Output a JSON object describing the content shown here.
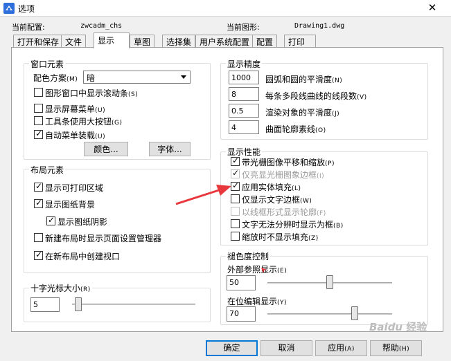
{
  "window": {
    "title": "选项",
    "close_glyph": "✕"
  },
  "header": {
    "current_config_label": "当前配置:",
    "current_config_value": "zwcadm_chs",
    "current_drawing_label": "当前图形:",
    "current_drawing_value": "Drawing1.dwg"
  },
  "tabs": [
    {
      "label": "打开和保存",
      "active": false
    },
    {
      "label": "文件",
      "active": false
    },
    {
      "label": "显示",
      "active": true
    },
    {
      "label": "草图",
      "active": false
    },
    {
      "label": "选择集",
      "active": false
    },
    {
      "label": "用户系统配置",
      "active": false
    },
    {
      "label": "配置",
      "active": false
    },
    {
      "label": "打印",
      "active": false
    }
  ],
  "window_elements": {
    "title": "窗口元素",
    "color_scheme_label": "配色方案",
    "color_scheme_key": "(M)",
    "color_scheme_value": "暗",
    "items": [
      {
        "label": "图形窗口中显示滚动条",
        "key": "(S)",
        "checked": false
      },
      {
        "label": "显示屏幕菜单",
        "key": "(U)",
        "checked": false
      },
      {
        "label": "工具条使用大按钮",
        "key": "(G)",
        "checked": false
      },
      {
        "label": "自动菜单装载",
        "key": "(U)",
        "checked": true
      }
    ],
    "colors_button": "颜色...",
    "fonts_button": "字体..."
  },
  "layout_elements": {
    "title": "布局元素",
    "items": [
      {
        "label": "显示可打印区域",
        "checked": true
      },
      {
        "label": "显示图纸背景",
        "checked": true
      },
      {
        "label": "显示图纸阴影",
        "checked": true
      },
      {
        "label": "新建布局时显示页面设置管理器",
        "checked": false
      },
      {
        "label": "在新布局中创建视口",
        "checked": true
      }
    ]
  },
  "crosshair": {
    "title": "十字光标大小",
    "key": "(R)",
    "value": "5",
    "level_fraction": 0.05
  },
  "display_precision": {
    "title": "显示精度",
    "rows": [
      {
        "value": "1000",
        "label": "圆弧和圆的平滑度",
        "key": "(N)"
      },
      {
        "value": "8",
        "label": "每条多段线曲线的线段数",
        "key": "(V)"
      },
      {
        "value": "0.5",
        "label": "渲染对象的平滑度",
        "key": "(J)"
      },
      {
        "value": "4",
        "label": "曲面轮廓素线",
        "key": "(O)"
      }
    ]
  },
  "display_performance": {
    "title": "显示性能",
    "items": [
      {
        "label": "带光栅图像平移和缩放",
        "key": "(P)",
        "checked": true,
        "disabled": false
      },
      {
        "label": "仅亮显光栅图象边框",
        "key": "(I)",
        "checked": true,
        "disabled": true
      },
      {
        "label": "应用实体填充",
        "key": "(L)",
        "checked": true,
        "disabled": false
      },
      {
        "label": "仅显示文字边框",
        "key": "(W)",
        "checked": false,
        "disabled": false
      },
      {
        "label": "以线框形式显示轮廓",
        "key": "(F)",
        "checked": false,
        "disabled": true
      },
      {
        "label": "文字无法分辨时显示为框",
        "key": "(B)",
        "checked": false,
        "disabled": false
      },
      {
        "label": "缩放时不显示填充",
        "key": "(Z)",
        "checked": false,
        "disabled": false
      }
    ]
  },
  "fade_control": {
    "title": "褪色度控制",
    "xref_label": "外部参照显示",
    "xref_key": "(E)",
    "xref_value": "50",
    "xref_level": 0.5,
    "inplace_label": "在位编辑显示",
    "inplace_key": "(Y)",
    "inplace_value": "70",
    "inplace_level": 0.7
  },
  "footer": {
    "ok": "确定",
    "cancel": "取消",
    "apply": "应用",
    "apply_key": "(A)",
    "help": "帮助",
    "help_key": "(H)"
  },
  "watermark": {
    "brand": "Baidu",
    "text": "经验"
  },
  "colors": {
    "accent": "#0078d7",
    "annotation_arrow": "#e8383d"
  }
}
